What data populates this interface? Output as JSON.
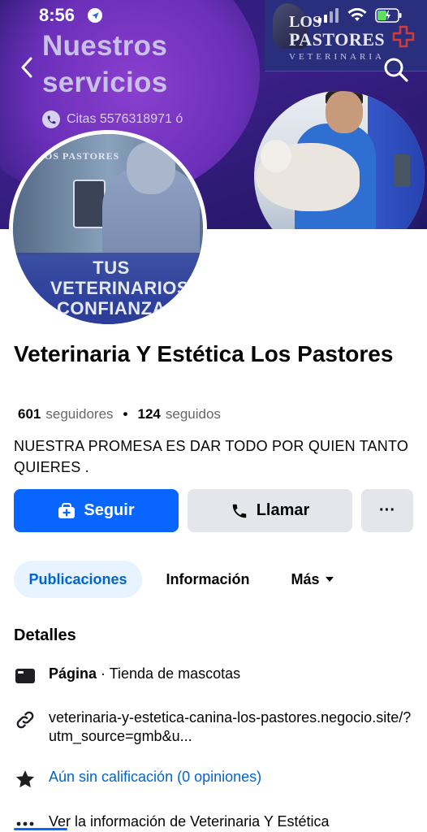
{
  "status_bar": {
    "time": "8:56"
  },
  "cover": {
    "headline_line1": "Nuestros",
    "headline_line2": "servicios",
    "citas_text": "Citas 5576318971 ó",
    "logo_line1": "LOS",
    "logo_line2": "PASTORES",
    "logo_line3": "VETERINARIA"
  },
  "avatar": {
    "logo_text": "LOS PASTORES",
    "line1": "TUS",
    "line2": "VETERINARIOS",
    "line3": "CONFIANZA"
  },
  "page": {
    "name": "Veterinaria Y Estética Los Pastores",
    "followers_count": "601",
    "followers_label": "seguidores",
    "following_count": "124",
    "following_label": "seguidos",
    "bio": "NUESTRA PROMESA ES DAR TODO POR QUIEN TANTO QUIERES ."
  },
  "actions": {
    "follow_label": "Seguir",
    "call_label": "Llamar",
    "more_label": "···"
  },
  "tabs": {
    "posts": "Publicaciones",
    "info": "Información",
    "more": "Más"
  },
  "details": {
    "title": "Detalles",
    "page_type_label": "Página",
    "page_type_value": " · Tienda de mascotas",
    "website": "veterinaria-y-estetica-canina-los-pastores.negocio.site/?utm_source=gmb&u...",
    "rating": "Aún sin calificación (0 opiniones)",
    "more_info": "Ver la información de Veterinaria Y Estética"
  },
  "colors": {
    "accent": "#0866ff",
    "tab_active_bg": "#e7f3ff",
    "button_gray": "#e4e6eb",
    "secondary_text": "#65676b"
  }
}
